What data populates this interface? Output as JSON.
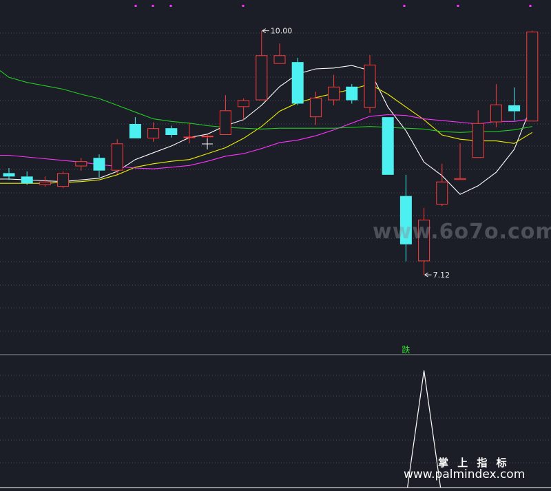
{
  "chart_data": {
    "type": "candlestick",
    "main_panel": {
      "price_range": [
        6.3,
        10.2
      ],
      "gridlines": true,
      "candles": [
        {
          "open": 8.32,
          "close": 8.28,
          "high": 8.38,
          "low": 8.24
        },
        {
          "open": 8.28,
          "close": 8.2,
          "high": 8.34,
          "low": 8.18
        },
        {
          "open": 8.18,
          "close": 8.22,
          "high": 8.28,
          "low": 8.16
        },
        {
          "open": 8.16,
          "close": 8.32,
          "high": 8.34,
          "low": 8.14
        },
        {
          "open": 8.4,
          "close": 8.46,
          "high": 8.5,
          "low": 8.35
        },
        {
          "open": 8.5,
          "close": 8.35,
          "high": 8.54,
          "low": 8.27
        },
        {
          "open": 8.35,
          "close": 8.67,
          "high": 8.72,
          "low": 8.31
        },
        {
          "open": 8.9,
          "close": 8.73,
          "high": 8.98,
          "low": 8.73
        },
        {
          "open": 8.73,
          "close": 8.85,
          "high": 8.92,
          "low": 8.69
        },
        {
          "open": 8.85,
          "close": 8.77,
          "high": 8.88,
          "low": 8.74
        },
        {
          "open": 8.74,
          "close": 8.75,
          "high": 8.91,
          "low": 8.67
        },
        {
          "open": 8.75,
          "close": 8.76,
          "high": 8.77,
          "low": 8.73
        },
        {
          "open": 8.77,
          "close": 9.06,
          "high": 9.24,
          "low": 8.77
        },
        {
          "open": 9.1,
          "close": 9.18,
          "high": 9.2,
          "low": 8.95
        },
        {
          "open": 9.18,
          "close": 9.71,
          "high": 10.0,
          "low": 9.18
        },
        {
          "open": 9.61,
          "close": 9.71,
          "high": 9.85,
          "low": 9.61
        },
        {
          "open": 9.63,
          "close": 9.14,
          "high": 9.68,
          "low": 9.12
        },
        {
          "open": 8.98,
          "close": 9.21,
          "high": 9.28,
          "low": 8.89
        },
        {
          "open": 9.18,
          "close": 9.34,
          "high": 9.48,
          "low": 9.12
        },
        {
          "open": 9.34,
          "close": 9.18,
          "high": 9.37,
          "low": 9.14
        },
        {
          "open": 9.09,
          "close": 9.6,
          "high": 9.71,
          "low": 9.03
        },
        {
          "open": 8.98,
          "close": 8.3,
          "high": 8.98,
          "low": 8.3
        },
        {
          "open": 8.05,
          "close": 7.48,
          "high": 8.3,
          "low": 7.28
        },
        {
          "open": 7.28,
          "close": 7.77,
          "high": 7.91,
          "low": 7.12
        },
        {
          "open": 7.95,
          "close": 8.22,
          "high": 8.43,
          "low": 7.93
        },
        {
          "open": 8.24,
          "close": 8.26,
          "high": 8.67,
          "low": 8.24
        },
        {
          "open": 8.5,
          "close": 8.91,
          "high": 9.06,
          "low": 8.5
        },
        {
          "open": 8.92,
          "close": 9.13,
          "high": 9.37,
          "low": 8.86
        },
        {
          "open": 9.12,
          "close": 9.05,
          "high": 9.33,
          "low": 8.94
        },
        {
          "open": 8.93,
          "close": 9.99,
          "high": 10.0,
          "low": 8.93
        }
      ],
      "moving_averages": [
        {
          "color": "#ffffff",
          "values": [
            8.25,
            8.24,
            8.23,
            8.22,
            8.24,
            8.26,
            8.34,
            8.48,
            8.56,
            8.64,
            8.74,
            8.78,
            8.88,
            8.95,
            9.12,
            9.34,
            9.49,
            9.55,
            9.56,
            9.59,
            9.53,
            9.1,
            8.82,
            8.45,
            8.29,
            8.07,
            8.17,
            8.33,
            8.6,
            9.14
          ]
        },
        {
          "color": "#f0f000",
          "values": [
            8.2,
            8.2,
            8.2,
            8.21,
            8.22,
            8.24,
            8.3,
            8.39,
            8.43,
            8.46,
            8.48,
            8.55,
            8.62,
            8.73,
            8.87,
            9.05,
            9.15,
            9.21,
            9.26,
            9.31,
            9.37,
            9.25,
            9.1,
            8.95,
            8.77,
            8.72,
            8.7,
            8.7,
            8.67,
            8.8
          ]
        },
        {
          "color": "#ff33ff",
          "values": [
            8.53,
            8.51,
            8.49,
            8.47,
            8.45,
            8.42,
            8.4,
            8.38,
            8.37,
            8.39,
            8.41,
            8.46,
            8.52,
            8.55,
            8.61,
            8.68,
            8.71,
            8.76,
            8.83,
            8.91,
            8.99,
            9.01,
            9.0,
            8.96,
            8.94,
            8.92,
            8.9,
            8.93,
            8.93,
            8.96
          ]
        },
        {
          "color": "#22cc22",
          "values": [
            9.45,
            9.39,
            9.35,
            9.31,
            9.25,
            9.2,
            9.12,
            9.04,
            8.96,
            8.93,
            8.91,
            8.88,
            8.86,
            8.85,
            8.84,
            8.85,
            8.85,
            8.85,
            8.85,
            8.86,
            8.87,
            8.86,
            8.85,
            8.84,
            8.81,
            8.8,
            8.81,
            8.81,
            8.83,
            8.87
          ]
        }
      ],
      "annotations": [
        {
          "text": "10.00",
          "candle_index": 14,
          "value": 10.0
        },
        {
          "text": "7.12",
          "candle_index": 23,
          "value": 7.12
        },
        {
          "text": "跌",
          "candle_index": 22
        }
      ]
    },
    "sub_panel": {
      "range": [
        0,
        1
      ],
      "values": [
        0,
        0,
        0,
        0,
        0,
        0,
        0,
        0,
        0,
        0,
        0,
        0,
        0,
        0,
        0,
        0,
        0,
        0,
        0,
        0,
        0,
        0,
        0,
        1,
        0,
        0,
        0,
        0,
        0,
        0
      ]
    },
    "watermarks": [
      "www.6o7o.com",
      "掌 上 指 标",
      "www.palmindex.com"
    ]
  },
  "colors": {
    "up": "#ff3b3b",
    "down": "#4cf0f0",
    "grid": "#4a4e58",
    "background": "#1b1e26",
    "marker": "#ff33ff"
  }
}
